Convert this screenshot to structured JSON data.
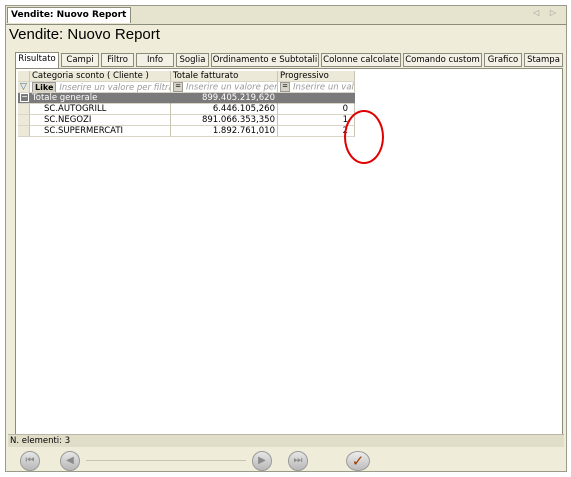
{
  "window": {
    "tab_title": "Vendite: Nuovo Report",
    "nav_arrows": "◁ ▷",
    "report_title": "Vendite: Nuovo Report"
  },
  "tabs": [
    {
      "label": "Risultato",
      "active": true
    },
    {
      "label": "Campi"
    },
    {
      "label": "Filtro"
    },
    {
      "label": "Info"
    },
    {
      "label": "Soglia"
    },
    {
      "label": "Ordinamento e Subtotali"
    },
    {
      "label": "Colonne calcolate"
    },
    {
      "label": "Comando custom"
    },
    {
      "label": "Grafico"
    },
    {
      "label": "Stampa"
    }
  ],
  "grid": {
    "columns": [
      "Categoria sconto ( Cliente )",
      "Totale fatturato",
      "Progressivo"
    ],
    "filter": {
      "like_label": "Like",
      "op_symbol": "=",
      "placeholder_1": "Inserire un valore per filtrare",
      "placeholder_2": "Inserire un valore per",
      "placeholder_3": "Inserire un valo"
    },
    "total_row": {
      "expander": "−",
      "label": "Totale generale",
      "value": "899.405.219,620",
      "progressivo": ""
    },
    "rows": [
      {
        "categoria": "SC.AUTOGRILL",
        "totale": "6.446.105,260",
        "progressivo": "0"
      },
      {
        "categoria": "SC.NEGOZI",
        "totale": "891.066.353,350",
        "progressivo": "1"
      },
      {
        "categoria": "SC.SUPERMERCATI",
        "totale": "1.892.761,010",
        "progressivo": "2"
      }
    ]
  },
  "status": {
    "count_text": "N. elementi: 3"
  },
  "navigation": {
    "first_icon": "⏮",
    "prev_icon": "◀",
    "next_icon": "▶",
    "last_icon": "⏭",
    "confirm_icon": "✓"
  },
  "colors": {
    "annotation": "#e00000",
    "total_row_bg": "#7a7a7a"
  }
}
